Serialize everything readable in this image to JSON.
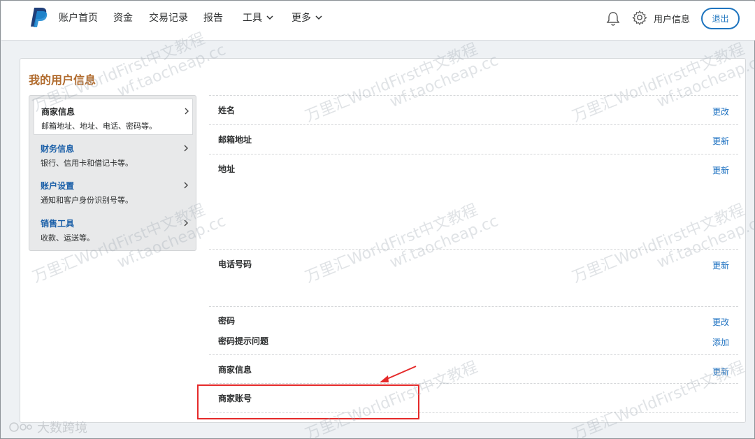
{
  "nav": {
    "items": [
      {
        "label": "账户首页",
        "dropdown": false
      },
      {
        "label": "资金",
        "dropdown": false
      },
      {
        "label": "交易记录",
        "dropdown": false
      },
      {
        "label": "报告",
        "dropdown": false
      },
      {
        "label": "工具",
        "dropdown": true
      },
      {
        "label": "更多",
        "dropdown": true
      }
    ],
    "profile_label": "用户信息",
    "logout_label": "退出"
  },
  "page": {
    "title": "我的用户信息"
  },
  "side_menu": [
    {
      "title": "商家信息",
      "desc": "邮箱地址、地址、电话、密码等。",
      "active": true
    },
    {
      "title": "财务信息",
      "desc": "银行、信用卡和借记卡等。",
      "active": false
    },
    {
      "title": "账户设置",
      "desc": "通知和客户身份识别号等。",
      "active": false
    },
    {
      "title": "销售工具",
      "desc": "收款、运送等。",
      "active": false
    }
  ],
  "rows": [
    {
      "label": "姓名",
      "action": "更改"
    },
    {
      "label": "邮箱地址",
      "action": "更新"
    },
    {
      "label": "地址",
      "action": "更新"
    },
    {
      "label": "电话号码",
      "action": "更新"
    },
    {
      "label": "密码",
      "action": "更改"
    },
    {
      "label": "密码提示问题",
      "action": "添加"
    },
    {
      "label": "商家信息",
      "action": "更新"
    },
    {
      "label": "商家账号",
      "action": ""
    }
  ],
  "watermark": {
    "line1": "万里汇WorldFirst中文教程",
    "line2": "wf.taocheap.cc"
  },
  "bottom_mark": "大数跨境",
  "colors": {
    "brand_blue": "#1f75bf",
    "link_blue": "#1a6fc0",
    "title_orange": "#b06a2c",
    "annotation_red": "#e52a2a"
  }
}
